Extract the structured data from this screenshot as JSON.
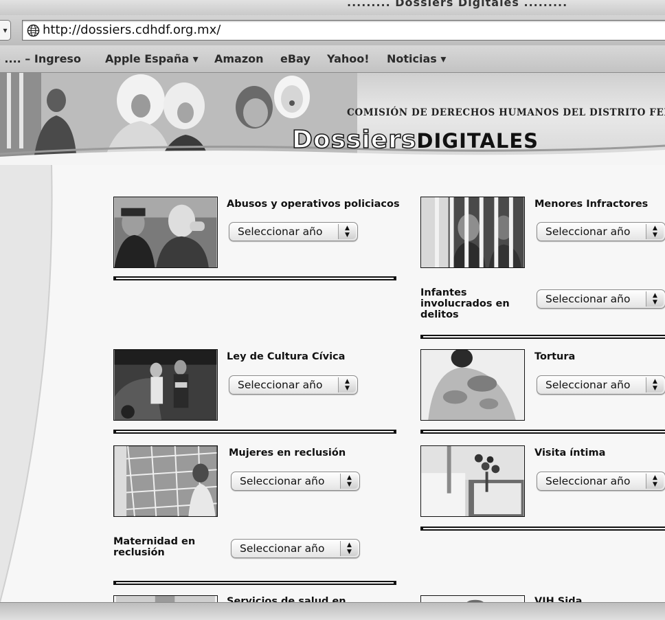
{
  "window": {
    "title": "......... Dossiers Digitales ........."
  },
  "toolbar": {
    "url": "http://dossiers.cdhdf.org.mx/"
  },
  "bookmarks": [
    {
      "label": "e .... – Ingreso"
    },
    {
      "label": "Apple España ▾"
    },
    {
      "label": "Amazon"
    },
    {
      "label": "eBay"
    },
    {
      "label": "Yahoo!"
    },
    {
      "label": "Noticias ▾"
    }
  ],
  "header": {
    "org": "COMISIÓN DE DERECHOS HUMANOS DEL DISTRITO FEDERAL",
    "logo_part1": "Dossiers",
    "logo_part2": "DIGITALES"
  },
  "select_label": "Seleccionar año",
  "dossiers": [
    {
      "title": "Abusos y operativos policiacos",
      "column": "left"
    },
    {
      "title": "Menores Infractores",
      "column": "right"
    },
    {
      "title": "Infantes involucrados en delitos",
      "column": "right"
    },
    {
      "title": "Ley de Cultura Cívica",
      "column": "left"
    },
    {
      "title": "Tortura",
      "column": "right"
    },
    {
      "title": "Mujeres en reclusión",
      "column": "left"
    },
    {
      "title": "Visita íntima",
      "column": "right"
    },
    {
      "title": "Maternidad en reclusión",
      "column": "left"
    },
    {
      "title": "Servicios de salud en",
      "column": "left"
    },
    {
      "title": "VIH Sida",
      "column": "right"
    }
  ],
  "icons": {
    "url_icon": "globe-icon",
    "select_icon": "up-down-arrows-icon"
  }
}
